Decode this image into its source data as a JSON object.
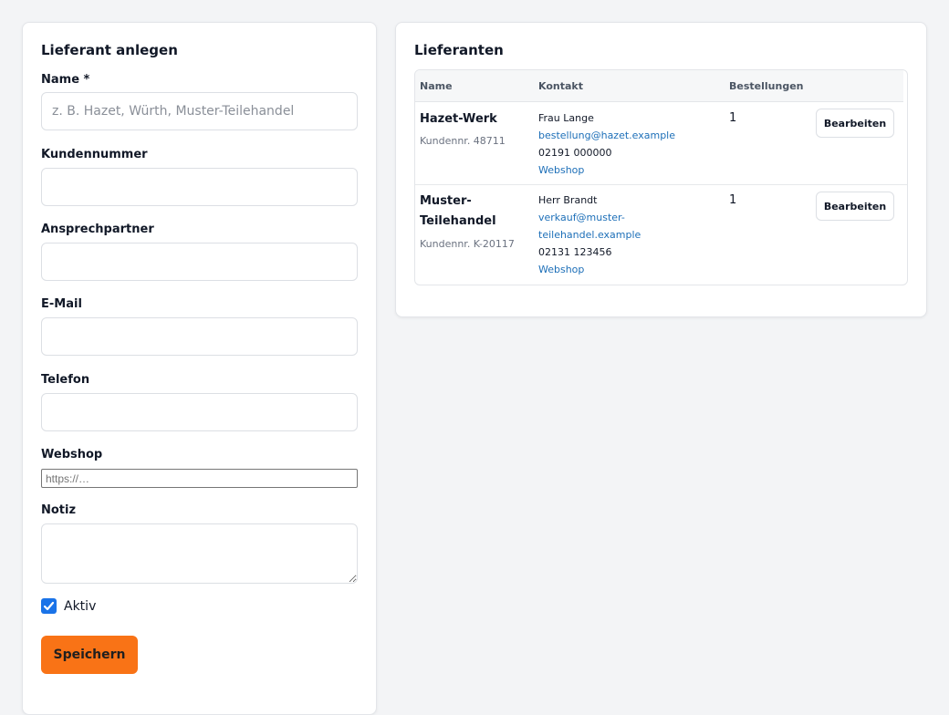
{
  "form": {
    "title": "Lieferant anlegen",
    "name_label": "Name *",
    "name_placeholder": "z. B. Hazet, Würth, Muster-Teilehandel",
    "kundennummer_label": "Kundennummer",
    "ansprechpartner_label": "Ansprechpartner",
    "email_label": "E-Mail",
    "telefon_label": "Telefon",
    "webshop_label": "Webshop",
    "webshop_placeholder": "https://…",
    "notiz_label": "Notiz",
    "aktiv_label": "Aktiv",
    "aktiv_checked": true,
    "save_label": "Speichern"
  },
  "list": {
    "title": "Lieferanten",
    "columns": [
      "Name",
      "Kontakt",
      "Bestellungen"
    ],
    "rows": [
      {
        "name_line1": "Hazet-Werk",
        "name_line2": "",
        "kundennr": "Kundennr. 48711",
        "contact_person": "Frau Lange",
        "email_line1": "bestellung@hazet.example",
        "email_line2": "",
        "phone": "02191 000000",
        "webshop": "Webshop",
        "orders": "1",
        "edit_label": "Bearbeiten"
      },
      {
        "name_line1": "Muster-",
        "name_line2": "Teilehandel",
        "kundennr": "Kundennr. K-20117",
        "contact_person": "Herr Brandt",
        "email_line1": "verkauf@muster-",
        "email_line2": "teilehandel.example",
        "phone": "02131 123456",
        "webshop": "Webshop",
        "orders": "1",
        "edit_label": "Bearbeiten"
      }
    ]
  },
  "colors": {
    "accent": "#f97316",
    "link": "#1d6fb8",
    "checkbox": "#1a73e8",
    "background": "#f3f4f6"
  }
}
